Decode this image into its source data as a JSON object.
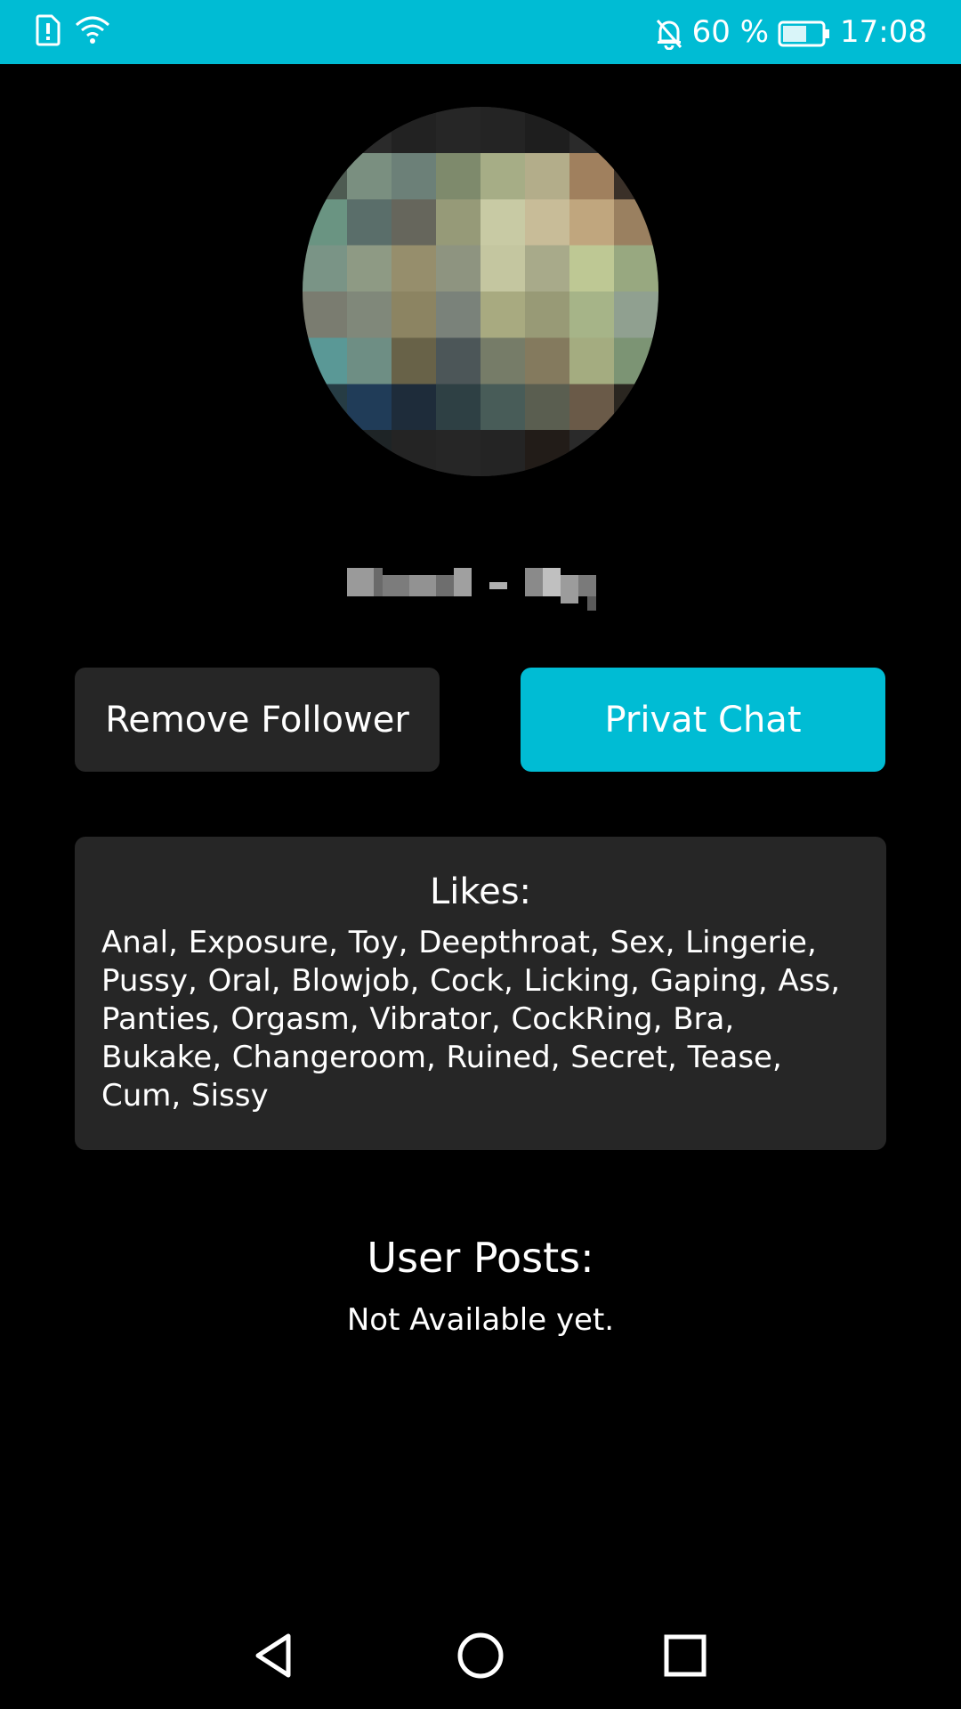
{
  "status_bar": {
    "battery": "60 %",
    "time": "17:08",
    "icons": [
      "sim-alert-icon",
      "wifi-icon",
      "notifications-off-icon",
      "battery-icon"
    ],
    "bg_color": "#00bcd4"
  },
  "profile": {
    "avatar": "blurred-profile-photo"
  },
  "actions": {
    "remove_follower_label": "Remove Follower",
    "privat_chat_label": "Privat Chat",
    "accent_color": "#00bcd4"
  },
  "likes": {
    "title": "Likes:",
    "text": "Anal, Exposure, Toy, Deepthroat, Sex, Lingerie, Pussy, Oral, Blowjob, Cock, Licking, Gaping, Ass, Panties, Orgasm, Vibrator, CockRing, Bra, Bukake, Changeroom, Ruined, Secret, Tease, Cum, Sissy"
  },
  "posts": {
    "title": "User Posts:",
    "status": "Not Available yet."
  },
  "nav_bar": {
    "icons": [
      "back-icon",
      "home-icon",
      "recents-icon"
    ]
  }
}
